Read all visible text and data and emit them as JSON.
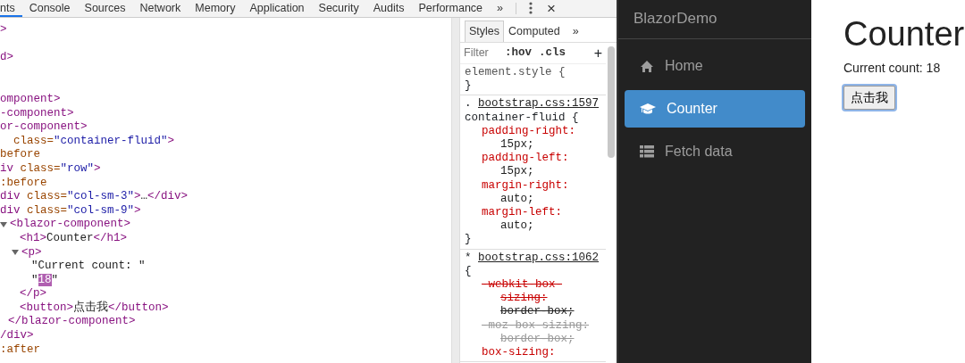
{
  "devtools": {
    "tabs": [
      {
        "label": "nts",
        "selected": true
      },
      {
        "label": "Console",
        "selected": false
      },
      {
        "label": "Sources",
        "selected": false
      },
      {
        "label": "Network",
        "selected": false
      },
      {
        "label": "Memory",
        "selected": false
      },
      {
        "label": "Application",
        "selected": false
      },
      {
        "label": "Security",
        "selected": false
      },
      {
        "label": "Audits",
        "selected": false
      },
      {
        "label": "Performance",
        "selected": false
      }
    ],
    "more_tabs": "»",
    "close": "×",
    "elements_tree": [
      {
        "tokens": [
          {
            "kind": "tag",
            "text": ">"
          }
        ]
      },
      {
        "kind": "blank"
      },
      {
        "tokens": [
          {
            "kind": "tag",
            "text": "d>"
          }
        ]
      },
      {
        "kind": "blank"
      },
      {
        "kind": "blank"
      },
      {
        "tokens": [
          {
            "kind": "tag",
            "text": "omponent>"
          }
        ]
      },
      {
        "tokens": [
          {
            "kind": "tag",
            "text": "-component>"
          }
        ]
      },
      {
        "tokens": [
          {
            "kind": "tag",
            "text": "or-component>"
          }
        ]
      },
      {
        "tokens": [
          {
            "kind": "attr",
            "text": "  class="
          },
          {
            "kind": "value",
            "text": "\"container-fluid\""
          },
          {
            "kind": "tag",
            "text": ">"
          }
        ]
      },
      {
        "tokens": [
          {
            "kind": "pseudo",
            "text": "before"
          }
        ]
      },
      {
        "tokens": [
          {
            "kind": "tag",
            "text": "iv "
          },
          {
            "kind": "attr",
            "text": "class="
          },
          {
            "kind": "value",
            "text": "\"row\""
          },
          {
            "kind": "tag",
            "text": ">"
          }
        ]
      },
      {
        "tokens": [
          {
            "kind": "pseudo",
            "text": ":before"
          }
        ]
      },
      {
        "tokens": [
          {
            "kind": "tag",
            "text": "div "
          },
          {
            "kind": "attr",
            "text": "class="
          },
          {
            "kind": "value",
            "text": "\"col-sm-3\""
          },
          {
            "kind": "tag",
            "text": ">"
          },
          {
            "kind": "text",
            "text": "…"
          },
          {
            "kind": "tag",
            "text": "</div>"
          }
        ]
      },
      {
        "tokens": [
          {
            "kind": "tag",
            "text": "div "
          },
          {
            "kind": "attr",
            "text": "class="
          },
          {
            "kind": "value",
            "text": "\"col-sm-9\""
          },
          {
            "kind": "tag",
            "text": ">"
          }
        ]
      },
      {
        "expanded": true,
        "tokens": [
          {
            "kind": "tag",
            "text": "<blazor-component>"
          }
        ],
        "children": [
          {
            "tokens": [
              {
                "kind": "tag",
                "text": "<h1>"
              },
              {
                "kind": "text",
                "text": "Counter"
              },
              {
                "kind": "tag",
                "text": "</h1>"
              }
            ]
          },
          {
            "expanded": true,
            "tokens": [
              {
                "kind": "tag",
                "text": "<p>"
              }
            ],
            "children": [
              {
                "tokens": [
                  {
                    "kind": "text",
                    "text": "\"Current count: \""
                  }
                ]
              },
              {
                "tokens": [
                  {
                    "kind": "text",
                    "text": "\""
                  },
                  {
                    "kind": "highlight",
                    "text": "18"
                  },
                  {
                    "kind": "text",
                    "text": "\""
                  }
                ]
              }
            ],
            "closing": [
              {
                "kind": "tag",
                "text": "</p>"
              }
            ]
          },
          {
            "tokens": [
              {
                "kind": "tag",
                "text": "<button>"
              },
              {
                "kind": "text",
                "text": "点击我"
              },
              {
                "kind": "tag",
                "text": "</button>"
              }
            ]
          }
        ],
        "closing": [
          {
            "kind": "tag",
            "text": "</blazor-component>"
          }
        ]
      },
      {
        "tokens": [
          {
            "kind": "tag",
            "text": "/div>"
          }
        ]
      },
      {
        "tokens": [
          {
            "kind": "pseudo",
            "text": ":after"
          }
        ]
      }
    ],
    "styles_tabs": [
      {
        "label": "Styles",
        "selected": true
      },
      {
        "label": "Computed",
        "selected": false
      }
    ],
    "styles_more": "»",
    "filter": {
      "placeholder": "Filter",
      "hov": ":hov",
      "cls": ".cls",
      "add": "+"
    },
    "element_style": {
      "selector": "element.style {",
      "close": "}"
    },
    "rules": [
      {
        "selector_head": ".",
        "source": "bootstrap.css:1597",
        "selector_tail": "container-fluid {",
        "close": "}",
        "properties": [
          {
            "name": "padding-right:",
            "value": "15px;",
            "overridden": false,
            "inactive": false
          },
          {
            "name": "padding-left:",
            "value": "15px;",
            "overridden": false,
            "inactive": false
          },
          {
            "name": "margin-right:",
            "value": "auto;",
            "overridden": false,
            "inactive": false
          },
          {
            "name": "margin-left:",
            "value": "auto;",
            "overridden": false,
            "inactive": false
          }
        ]
      },
      {
        "selector_head": "*",
        "source": "bootstrap.css:1062",
        "selector_tail": "{",
        "properties": [
          {
            "name": "-webkit-box-sizing:",
            "value": "border-box;",
            "overridden": true,
            "inactive": false
          },
          {
            "name": "-moz-box-sizing:",
            "value": "border-box;",
            "overridden": true,
            "inactive": true
          },
          {
            "name": "box-sizing:",
            "overridden": false,
            "inactive": false
          }
        ]
      }
    ]
  },
  "app": {
    "brand": "BlazorDemo",
    "nav": [
      {
        "label": "Home",
        "kind": "home",
        "selected": false
      },
      {
        "label": "Counter",
        "kind": "cap",
        "selected": true
      },
      {
        "label": "Fetch data",
        "kind": "list",
        "selected": false
      }
    ],
    "heading": "Counter",
    "count_text": "Current count: 18",
    "button": "点击我"
  }
}
